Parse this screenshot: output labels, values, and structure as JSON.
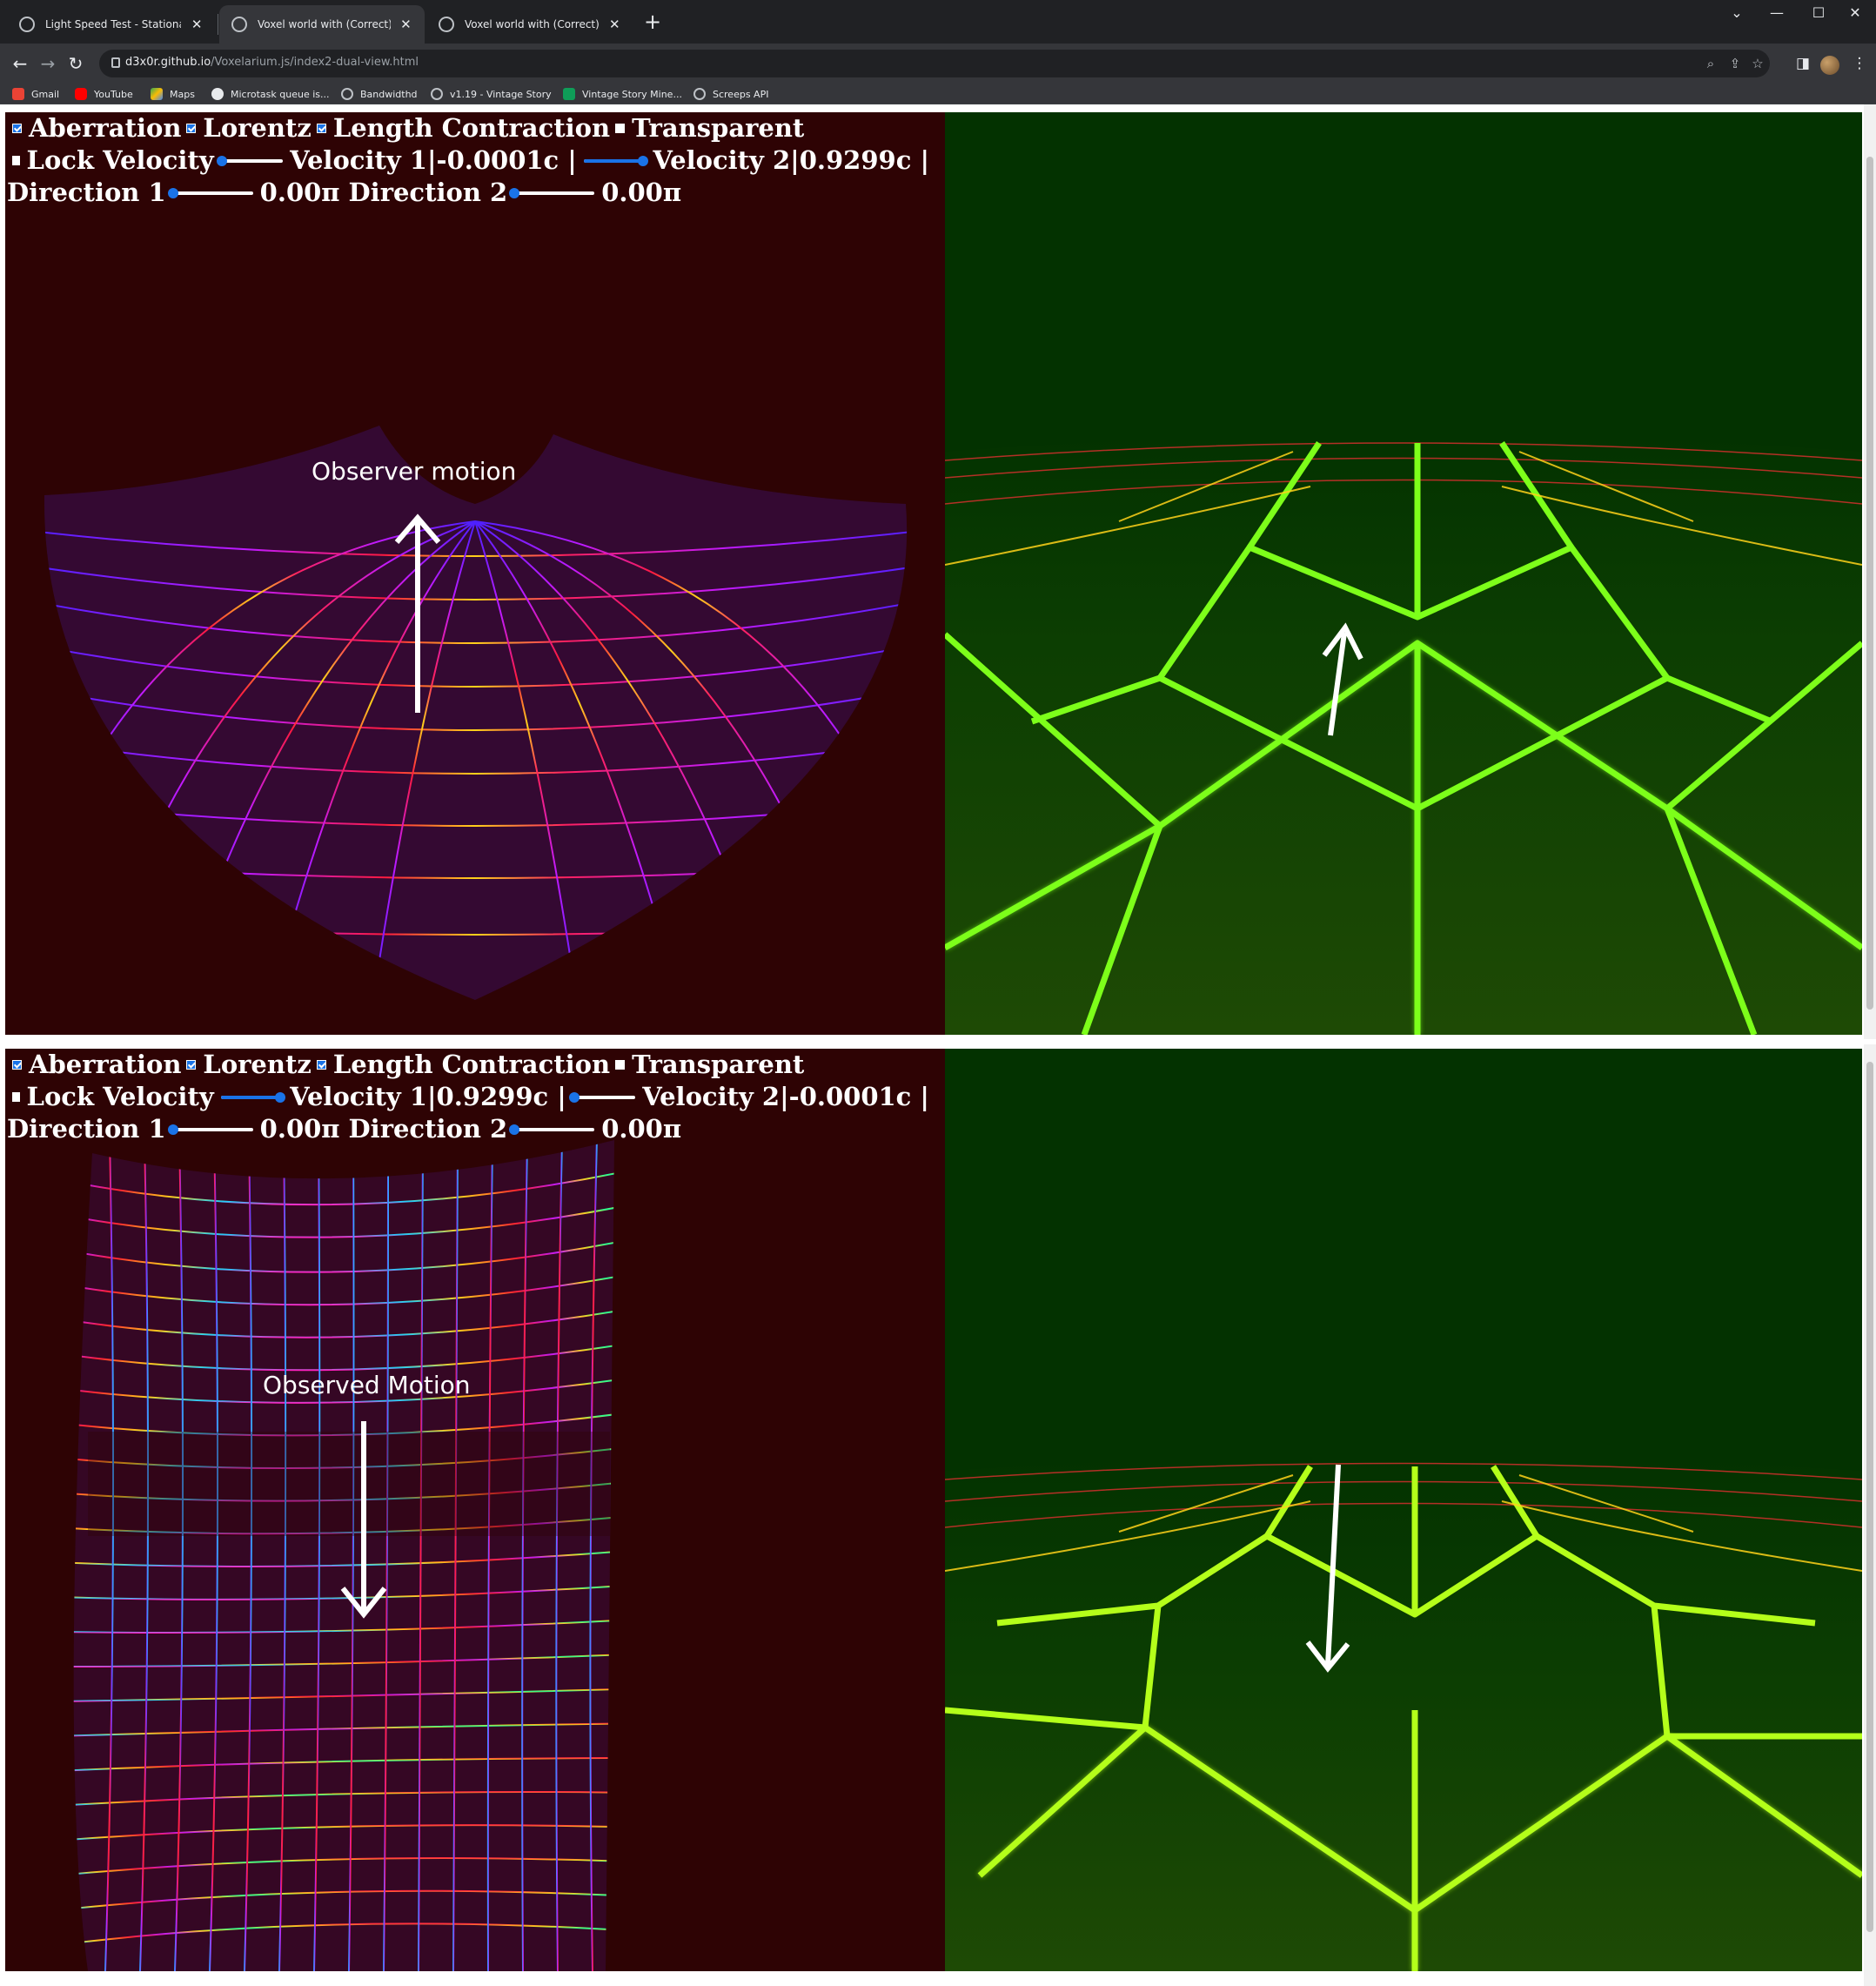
{
  "browser": {
    "tabs": [
      {
        "title": "Light Speed Test - Stationary tra",
        "active": false
      },
      {
        "title": "Voxel world with (Correct)Relativ",
        "active": true
      },
      {
        "title": "Voxel world with (Correct)Relativ",
        "active": false
      }
    ],
    "window_controls": {
      "minimize": "—",
      "maximize": "☐",
      "close": "✕",
      "tab_search": "⌄"
    },
    "url": {
      "host": "d3x0r.github.io",
      "path": "/Voxelarium.js/index2-dual-view.html"
    },
    "bookmarks": [
      {
        "label": "Gmail",
        "icon": "gmail-icon",
        "color": "#ea4335"
      },
      {
        "label": "YouTube",
        "icon": "youtube-icon",
        "color": "#ff0000"
      },
      {
        "label": "Maps",
        "icon": "maps-icon",
        "color": "#34a853"
      },
      {
        "label": "Microtask queue is...",
        "icon": "github-icon",
        "color": "#e8eaed"
      },
      {
        "label": "Bandwidthd",
        "icon": "globe-icon",
        "color": "#bdc1c6"
      },
      {
        "label": "v1.19 - Vintage Story",
        "icon": "globe-icon",
        "color": "#bdc1c6"
      },
      {
        "label": "Vintage Story Mine...",
        "icon": "sheets-icon",
        "color": "#0f9d58"
      },
      {
        "label": "Screeps API",
        "icon": "globe-icon",
        "color": "#bdc1c6"
      }
    ]
  },
  "views": [
    {
      "checkboxes": {
        "aberration": "Aberration",
        "lorentz": "Lorentz",
        "length_contraction": "Length Contraction",
        "transparent": "Transparent",
        "lock_velocity": "Lock Velocity"
      },
      "velocity1": {
        "label": "Velocity 1|-0.0001c |",
        "fraction": 0.02
      },
      "velocity2": {
        "label": "Velocity 2|0.9299c |",
        "fraction": 0.96
      },
      "direction1": {
        "label": "0.00π",
        "prefix": "Direction 1",
        "fraction": 0.0
      },
      "direction2": {
        "label": "0.00π",
        "prefix": "Direction 2",
        "fraction": 0.0
      },
      "annotation": "Observer motion"
    },
    {
      "checkboxes": {
        "aberration": "Aberration",
        "lorentz": "Lorentz",
        "length_contraction": "Length Contraction",
        "transparent": "Transparent",
        "lock_velocity": "Lock Velocity"
      },
      "velocity1": {
        "label": "Velocity 1|0.9299c |",
        "fraction": 0.96
      },
      "velocity2": {
        "label": "Velocity 2|-0.0001c |",
        "fraction": 0.02
      },
      "direction1": {
        "label": "0.00π",
        "prefix": "Direction 1",
        "fraction": 0.0
      },
      "direction2": {
        "label": "0.00π",
        "prefix": "Direction 2",
        "fraction": 0.0
      },
      "annotation": "Observed Motion"
    }
  ],
  "colors": {
    "left_bg": "#2e0304",
    "right_bg": "#033200",
    "grid_green": "#7dff1a",
    "accent": "#1a73e8"
  }
}
